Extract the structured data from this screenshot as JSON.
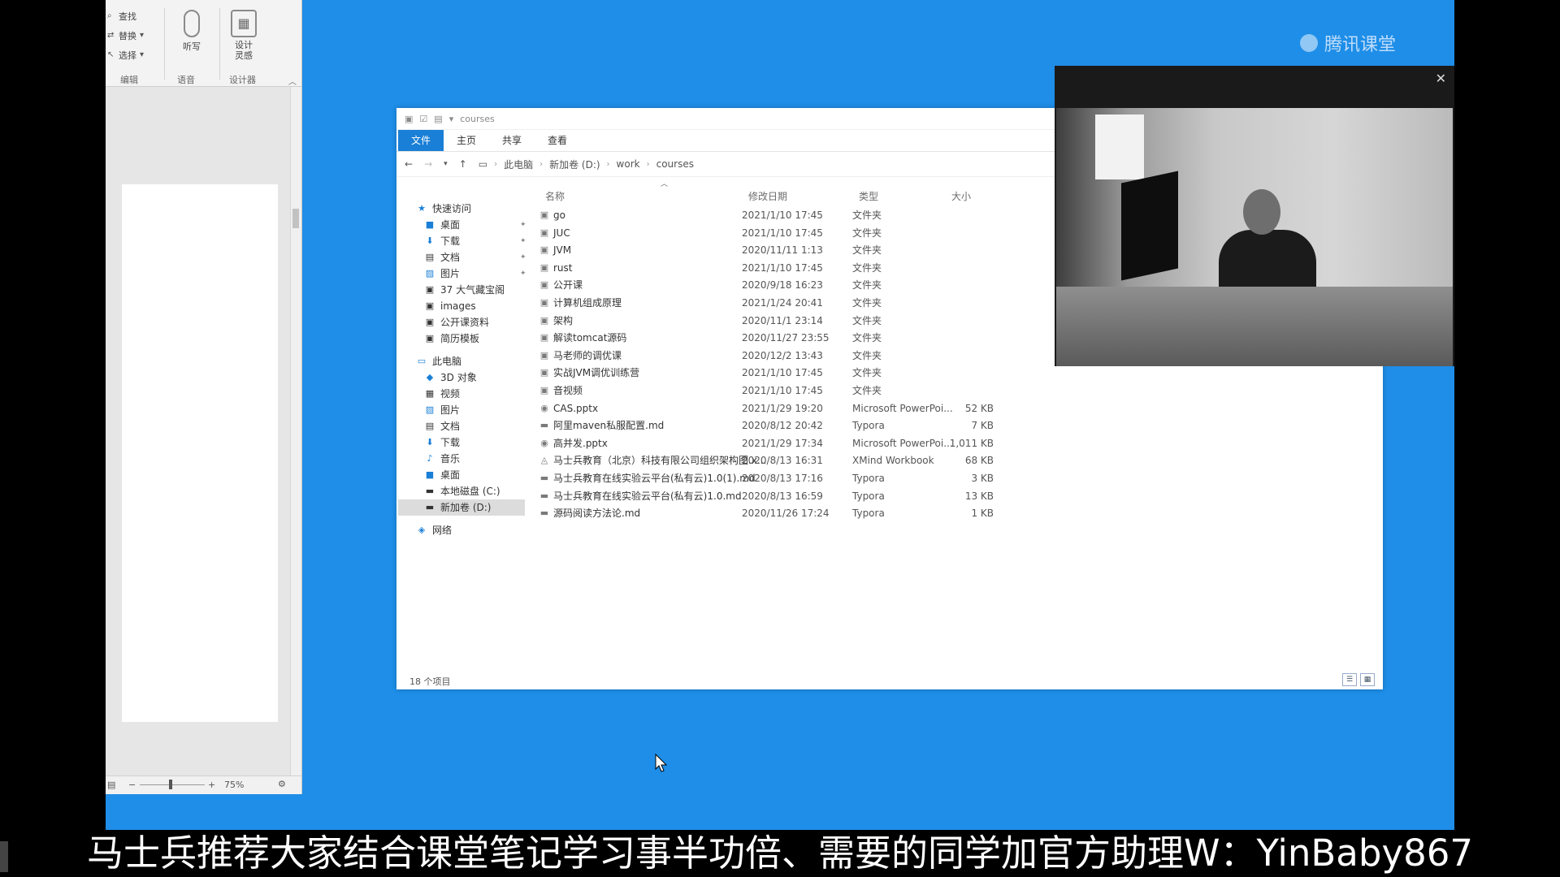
{
  "word": {
    "ribbon": {
      "find": "查找",
      "replace": "替换",
      "select": "选择",
      "dictate": "听写",
      "designer": "设计\n灵感",
      "group_edit": "编辑",
      "group_voice": "语音",
      "group_designer": "设计器"
    },
    "zoom": "75%"
  },
  "watermark": "腾讯课堂",
  "explorer": {
    "title": "courses",
    "tabs": [
      "文件",
      "主页",
      "共享",
      "查看"
    ],
    "breadcrumb": [
      "此电脑",
      "新加卷 (D:)",
      "work",
      "courses"
    ],
    "nav": {
      "quick_access": "快速访问",
      "quick_items": [
        "桌面",
        "下载",
        "文档",
        "图片",
        "37 大气藏宝阁",
        "images",
        "公开课资料",
        "简历模板"
      ],
      "this_pc": "此电脑",
      "pc_items": [
        "3D 对象",
        "视频",
        "图片",
        "文档",
        "下载",
        "音乐",
        "桌面",
        "本地磁盘 (C:)",
        "新加卷 (D:)"
      ],
      "network": "网络"
    },
    "columns": {
      "name": "名称",
      "date": "修改日期",
      "type": "类型",
      "size": "大小"
    },
    "files": [
      {
        "name": "go",
        "date": "2021/1/10 17:45",
        "type": "文件夹",
        "size": "",
        "icon": "folder"
      },
      {
        "name": "JUC",
        "date": "2021/1/10 17:45",
        "type": "文件夹",
        "size": "",
        "icon": "folder"
      },
      {
        "name": "JVM",
        "date": "2020/11/11 1:13",
        "type": "文件夹",
        "size": "",
        "icon": "folder"
      },
      {
        "name": "rust",
        "date": "2021/1/10 17:45",
        "type": "文件夹",
        "size": "",
        "icon": "folder"
      },
      {
        "name": "公开课",
        "date": "2020/9/18 16:23",
        "type": "文件夹",
        "size": "",
        "icon": "folder"
      },
      {
        "name": "计算机组成原理",
        "date": "2021/1/24 20:41",
        "type": "文件夹",
        "size": "",
        "icon": "folder"
      },
      {
        "name": "架构",
        "date": "2020/11/1 23:14",
        "type": "文件夹",
        "size": "",
        "icon": "folder"
      },
      {
        "name": "解读tomcat源码",
        "date": "2020/11/27 23:55",
        "type": "文件夹",
        "size": "",
        "icon": "folder"
      },
      {
        "name": "马老师的调优课",
        "date": "2020/12/2 13:43",
        "type": "文件夹",
        "size": "",
        "icon": "folder"
      },
      {
        "name": "实战JVM调优训练营",
        "date": "2021/1/10 17:45",
        "type": "文件夹",
        "size": "",
        "icon": "folder"
      },
      {
        "name": "音视频",
        "date": "2021/1/10 17:45",
        "type": "文件夹",
        "size": "",
        "icon": "folder"
      },
      {
        "name": "CAS.pptx",
        "date": "2021/1/29 19:20",
        "type": "Microsoft PowerPoi...",
        "size": "52 KB",
        "icon": "pptx"
      },
      {
        "name": "阿里maven私服配置.md",
        "date": "2020/8/12 20:42",
        "type": "Typora",
        "size": "7 KB",
        "icon": "md"
      },
      {
        "name": "高并发.pptx",
        "date": "2021/1/29 17:34",
        "type": "Microsoft PowerPoi...",
        "size": "1,011 KB",
        "icon": "pptx"
      },
      {
        "name": "马士兵教育（北京）科技有限公司组织架构图.x...",
        "date": "2020/8/13 16:31",
        "type": "XMind Workbook",
        "size": "68 KB",
        "icon": "xmind"
      },
      {
        "name": "马士兵教育在线实验云平台(私有云)1.0(1).md",
        "date": "2020/8/13 17:16",
        "type": "Typora",
        "size": "3 KB",
        "icon": "md"
      },
      {
        "name": "马士兵教育在线实验云平台(私有云)1.0.md",
        "date": "2020/8/13 16:59",
        "type": "Typora",
        "size": "13 KB",
        "icon": "md"
      },
      {
        "name": "源码阅读方法论.md",
        "date": "2020/11/26 17:24",
        "type": "Typora",
        "size": "1 KB",
        "icon": "md"
      }
    ],
    "status": "18 个项目"
  },
  "caption": "马士兵推荐大家结合课堂笔记学习事半功倍、需要的同学加官方助理W：YinBaby867"
}
